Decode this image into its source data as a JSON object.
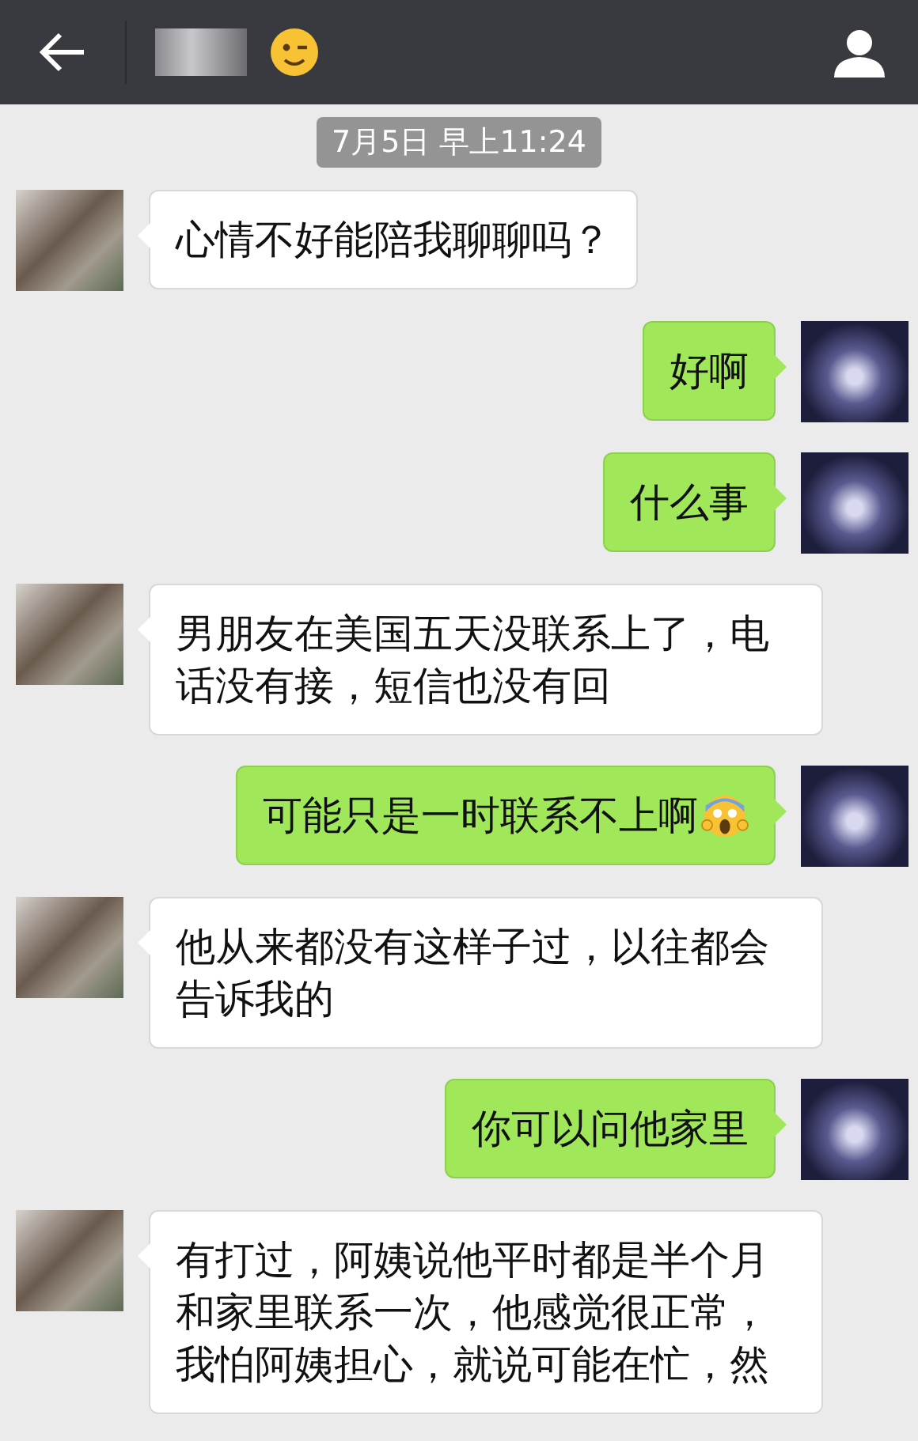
{
  "timestamp": "7月5日 早上11:24",
  "messages": [
    {
      "kind": "incoming",
      "text": "心情不好能陪我聊聊吗？"
    },
    {
      "kind": "outgoing",
      "text": "好啊"
    },
    {
      "kind": "outgoing",
      "text": "什么事"
    },
    {
      "kind": "incoming",
      "text": "男朋友在美国五天没联系上了，电话没有接，短信也没有回"
    },
    {
      "kind": "outgoing",
      "text": "可能只是一时联系不上啊",
      "emoji": true
    },
    {
      "kind": "incoming",
      "text": "他从来都没有这样子过，以往都会告诉我的"
    },
    {
      "kind": "outgoing",
      "text": "你可以问他家里"
    },
    {
      "kind": "incoming",
      "text": "有打过，阿姨说他平时都是半个月和家里联系一次，他感觉很正常，我怕阿姨担心，就说可能在忙，然"
    }
  ]
}
